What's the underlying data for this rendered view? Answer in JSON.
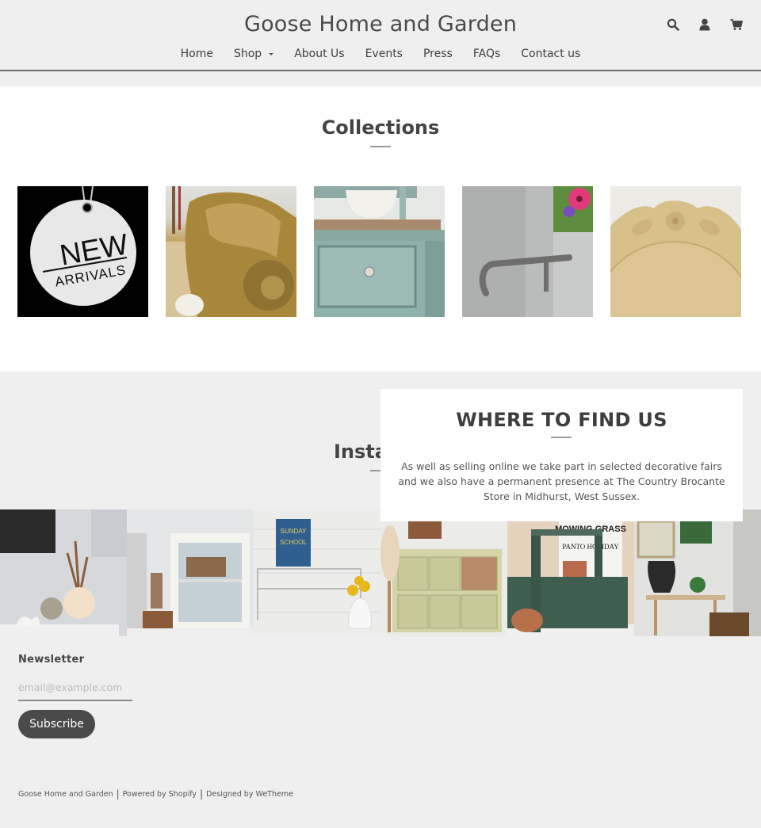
{
  "header": {
    "site_title": "Goose Home and Garden",
    "icons": [
      "search-icon",
      "account-icon",
      "cart-icon"
    ],
    "nav": [
      {
        "label": "Home"
      },
      {
        "label": "Shop",
        "has_dropdown": true
      },
      {
        "label": "About Us"
      },
      {
        "label": "Events"
      },
      {
        "label": "Press"
      },
      {
        "label": "FAQs"
      },
      {
        "label": "Contact us"
      }
    ]
  },
  "collections": {
    "title": "Collections",
    "items": [
      {
        "name": "New Arrivals",
        "image_text_1": "NEW",
        "image_text_2": "ARRIVALS"
      },
      {
        "name": "gilded-carving"
      },
      {
        "name": "painted-drawer"
      },
      {
        "name": "galvanised-bucket"
      },
      {
        "name": "carved-bread-board"
      }
    ]
  },
  "instagram": {
    "title": "Instagram",
    "tiles": [
      {
        "name": "dried-flowers-shelf"
      },
      {
        "name": "white-cabinet"
      },
      {
        "name": "sunday-school-sign",
        "image_text": "SUNDAY SCHOOL"
      },
      {
        "name": "chippy-cupboard"
      },
      {
        "name": "green-trug",
        "image_text": "MOWING GRASS"
      },
      {
        "name": "mannequin-table"
      }
    ]
  },
  "where_to_find": {
    "title": "WHERE TO FIND US",
    "text": "As well as selling online we take part in selected decorative fairs and we also have a permanent presence at The Country Brocante Store in Midhurst, West Sussex."
  },
  "newsletter": {
    "label": "Newsletter",
    "email_value": "",
    "email_placeholder": "email@example.com",
    "subscribe_label": "Subscribe"
  },
  "footer": {
    "copyright": "Goose Home and Garden",
    "powered": "Powered by Shopify",
    "designed": "Designed by WeTheme",
    "separator": "|"
  }
}
